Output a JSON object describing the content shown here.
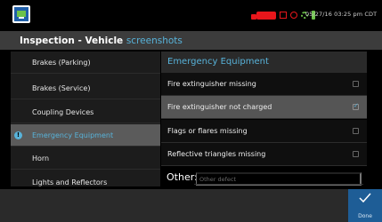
{
  "status": {
    "datetime": "05/27/16 03:25 pm CDT",
    "colors": {
      "truck": "#e8161b",
      "ok": "#6cc24a"
    }
  },
  "header": {
    "title": "Inspection - Vehicle",
    "subtitle": "screenshots"
  },
  "sidebar": {
    "items": [
      {
        "label": "Brakes (Parking)"
      },
      {
        "label": "Brakes (Service)"
      },
      {
        "label": "Coupling Devices"
      },
      {
        "label": "Emergency Equipment",
        "active": true
      },
      {
        "label": "Horn"
      },
      {
        "label": "Lights and Reflectors"
      }
    ],
    "active_icon": "!"
  },
  "panel": {
    "title": "Emergency Equipment",
    "items": [
      {
        "label": "Fire extinguisher missing",
        "checked": false
      },
      {
        "label": "Fire extinguisher not charged",
        "checked": true
      },
      {
        "label": "Flags or flares missing",
        "checked": false
      },
      {
        "label": "Reflective triangles missing",
        "checked": false
      }
    ]
  },
  "other": {
    "label": "Other:",
    "placeholder": "Other defect"
  },
  "footer": {
    "done_label": "Done"
  },
  "colors": {
    "accent": "#58b3da",
    "done_bg": "#1e5d96"
  }
}
